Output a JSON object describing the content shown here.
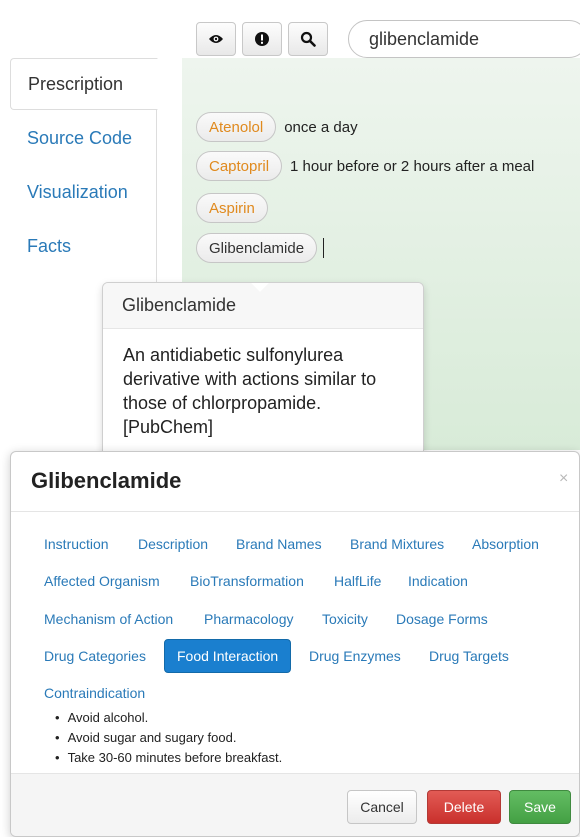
{
  "toolbar": {
    "buttons": [
      {
        "icon": "eye-icon"
      },
      {
        "icon": "exclamation-icon"
      },
      {
        "icon": "search-icon"
      }
    ],
    "search": {
      "value": "glibenclamide"
    }
  },
  "sidebar": {
    "tabs": [
      {
        "label": "Prescription",
        "active": true
      },
      {
        "label": "Source Code",
        "active": false
      },
      {
        "label": "Visualization",
        "active": false
      },
      {
        "label": "Facts",
        "active": false
      }
    ]
  },
  "prescription": {
    "items": [
      {
        "drug": "Atenolol",
        "instruction": "once a day"
      },
      {
        "drug": "Captopril",
        "instruction": "1 hour before or 2 hours after a meal"
      },
      {
        "drug": "Aspirin",
        "instruction": ""
      },
      {
        "drug": "Glibenclamide",
        "instruction": ""
      }
    ]
  },
  "popover": {
    "title": "Glibenclamide",
    "body": "An antidiabetic sulfonylurea derivative with actions similar to those of chlorpropamide. [PubChem]"
  },
  "modal": {
    "title": "Glibenclamide",
    "close": "×",
    "tags": [
      "Instruction",
      "Description",
      "Brand Names",
      "Brand Mixtures",
      "Absorption",
      "Affected Organism",
      "BioTransformation",
      "HalfLife",
      "Indication",
      "Mechanism of Action",
      "Pharmacology",
      "Toxicity",
      "Dosage Forms",
      "Drug Categories",
      "Food Interaction",
      "Drug Enzymes",
      "Drug Targets",
      "Contraindication"
    ],
    "active_tag": "Food Interaction",
    "content": [
      "Avoid alcohol.",
      "Avoid sugar and sugary food.",
      "Take 30-60 minutes before breakfast."
    ],
    "footer": {
      "cancel": "Cancel",
      "delete": "Delete",
      "save": "Save"
    }
  },
  "colors": {
    "link": "#2a7ab8",
    "drug_pill_text": "#e08a1e",
    "active_tag": "#1a7fcf",
    "delete": "#c9302c",
    "save": "#44a044"
  }
}
